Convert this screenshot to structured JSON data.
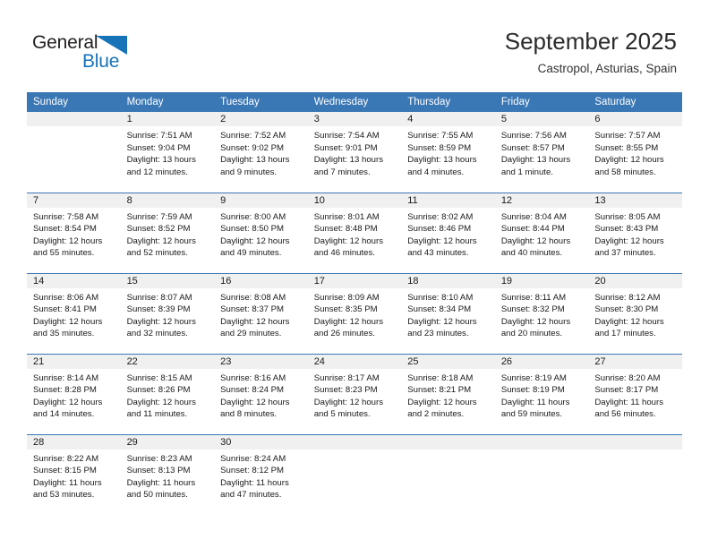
{
  "brand": {
    "name_top": "General",
    "name_bottom": "Blue",
    "accent_color": "#1673b8"
  },
  "header": {
    "title": "September 2025",
    "subtitle": "Castropol, Asturias, Spain"
  },
  "theme": {
    "header_row_color": "#3a77b5",
    "daynum_band_color": "#f0f0f0",
    "text_color": "#1a1a1a"
  },
  "weekday_headers": [
    "Sunday",
    "Monday",
    "Tuesday",
    "Wednesday",
    "Thursday",
    "Friday",
    "Saturday"
  ],
  "weeks": [
    [
      {
        "day": "",
        "blank": true,
        "sunrise": "",
        "sunset": "",
        "daylight_line1": "",
        "daylight_line2": ""
      },
      {
        "day": "1",
        "sunrise": "Sunrise: 7:51 AM",
        "sunset": "Sunset: 9:04 PM",
        "daylight_line1": "Daylight: 13 hours",
        "daylight_line2": "and 12 minutes."
      },
      {
        "day": "2",
        "sunrise": "Sunrise: 7:52 AM",
        "sunset": "Sunset: 9:02 PM",
        "daylight_line1": "Daylight: 13 hours",
        "daylight_line2": "and 9 minutes."
      },
      {
        "day": "3",
        "sunrise": "Sunrise: 7:54 AM",
        "sunset": "Sunset: 9:01 PM",
        "daylight_line1": "Daylight: 13 hours",
        "daylight_line2": "and 7 minutes."
      },
      {
        "day": "4",
        "sunrise": "Sunrise: 7:55 AM",
        "sunset": "Sunset: 8:59 PM",
        "daylight_line1": "Daylight: 13 hours",
        "daylight_line2": "and 4 minutes."
      },
      {
        "day": "5",
        "sunrise": "Sunrise: 7:56 AM",
        "sunset": "Sunset: 8:57 PM",
        "daylight_line1": "Daylight: 13 hours",
        "daylight_line2": "and 1 minute."
      },
      {
        "day": "6",
        "sunrise": "Sunrise: 7:57 AM",
        "sunset": "Sunset: 8:55 PM",
        "daylight_line1": "Daylight: 12 hours",
        "daylight_line2": "and 58 minutes."
      }
    ],
    [
      {
        "day": "7",
        "sunrise": "Sunrise: 7:58 AM",
        "sunset": "Sunset: 8:54 PM",
        "daylight_line1": "Daylight: 12 hours",
        "daylight_line2": "and 55 minutes."
      },
      {
        "day": "8",
        "sunrise": "Sunrise: 7:59 AM",
        "sunset": "Sunset: 8:52 PM",
        "daylight_line1": "Daylight: 12 hours",
        "daylight_line2": "and 52 minutes."
      },
      {
        "day": "9",
        "sunrise": "Sunrise: 8:00 AM",
        "sunset": "Sunset: 8:50 PM",
        "daylight_line1": "Daylight: 12 hours",
        "daylight_line2": "and 49 minutes."
      },
      {
        "day": "10",
        "sunrise": "Sunrise: 8:01 AM",
        "sunset": "Sunset: 8:48 PM",
        "daylight_line1": "Daylight: 12 hours",
        "daylight_line2": "and 46 minutes."
      },
      {
        "day": "11",
        "sunrise": "Sunrise: 8:02 AM",
        "sunset": "Sunset: 8:46 PM",
        "daylight_line1": "Daylight: 12 hours",
        "daylight_line2": "and 43 minutes."
      },
      {
        "day": "12",
        "sunrise": "Sunrise: 8:04 AM",
        "sunset": "Sunset: 8:44 PM",
        "daylight_line1": "Daylight: 12 hours",
        "daylight_line2": "and 40 minutes."
      },
      {
        "day": "13",
        "sunrise": "Sunrise: 8:05 AM",
        "sunset": "Sunset: 8:43 PM",
        "daylight_line1": "Daylight: 12 hours",
        "daylight_line2": "and 37 minutes."
      }
    ],
    [
      {
        "day": "14",
        "sunrise": "Sunrise: 8:06 AM",
        "sunset": "Sunset: 8:41 PM",
        "daylight_line1": "Daylight: 12 hours",
        "daylight_line2": "and 35 minutes."
      },
      {
        "day": "15",
        "sunrise": "Sunrise: 8:07 AM",
        "sunset": "Sunset: 8:39 PM",
        "daylight_line1": "Daylight: 12 hours",
        "daylight_line2": "and 32 minutes."
      },
      {
        "day": "16",
        "sunrise": "Sunrise: 8:08 AM",
        "sunset": "Sunset: 8:37 PM",
        "daylight_line1": "Daylight: 12 hours",
        "daylight_line2": "and 29 minutes."
      },
      {
        "day": "17",
        "sunrise": "Sunrise: 8:09 AM",
        "sunset": "Sunset: 8:35 PM",
        "daylight_line1": "Daylight: 12 hours",
        "daylight_line2": "and 26 minutes."
      },
      {
        "day": "18",
        "sunrise": "Sunrise: 8:10 AM",
        "sunset": "Sunset: 8:34 PM",
        "daylight_line1": "Daylight: 12 hours",
        "daylight_line2": "and 23 minutes."
      },
      {
        "day": "19",
        "sunrise": "Sunrise: 8:11 AM",
        "sunset": "Sunset: 8:32 PM",
        "daylight_line1": "Daylight: 12 hours",
        "daylight_line2": "and 20 minutes."
      },
      {
        "day": "20",
        "sunrise": "Sunrise: 8:12 AM",
        "sunset": "Sunset: 8:30 PM",
        "daylight_line1": "Daylight: 12 hours",
        "daylight_line2": "and 17 minutes."
      }
    ],
    [
      {
        "day": "21",
        "sunrise": "Sunrise: 8:14 AM",
        "sunset": "Sunset: 8:28 PM",
        "daylight_line1": "Daylight: 12 hours",
        "daylight_line2": "and 14 minutes."
      },
      {
        "day": "22",
        "sunrise": "Sunrise: 8:15 AM",
        "sunset": "Sunset: 8:26 PM",
        "daylight_line1": "Daylight: 12 hours",
        "daylight_line2": "and 11 minutes."
      },
      {
        "day": "23",
        "sunrise": "Sunrise: 8:16 AM",
        "sunset": "Sunset: 8:24 PM",
        "daylight_line1": "Daylight: 12 hours",
        "daylight_line2": "and 8 minutes."
      },
      {
        "day": "24",
        "sunrise": "Sunrise: 8:17 AM",
        "sunset": "Sunset: 8:23 PM",
        "daylight_line1": "Daylight: 12 hours",
        "daylight_line2": "and 5 minutes."
      },
      {
        "day": "25",
        "sunrise": "Sunrise: 8:18 AM",
        "sunset": "Sunset: 8:21 PM",
        "daylight_line1": "Daylight: 12 hours",
        "daylight_line2": "and 2 minutes."
      },
      {
        "day": "26",
        "sunrise": "Sunrise: 8:19 AM",
        "sunset": "Sunset: 8:19 PM",
        "daylight_line1": "Daylight: 11 hours",
        "daylight_line2": "and 59 minutes."
      },
      {
        "day": "27",
        "sunrise": "Sunrise: 8:20 AM",
        "sunset": "Sunset: 8:17 PM",
        "daylight_line1": "Daylight: 11 hours",
        "daylight_line2": "and 56 minutes."
      }
    ],
    [
      {
        "day": "28",
        "sunrise": "Sunrise: 8:22 AM",
        "sunset": "Sunset: 8:15 PM",
        "daylight_line1": "Daylight: 11 hours",
        "daylight_line2": "and 53 minutes."
      },
      {
        "day": "29",
        "sunrise": "Sunrise: 8:23 AM",
        "sunset": "Sunset: 8:13 PM",
        "daylight_line1": "Daylight: 11 hours",
        "daylight_line2": "and 50 minutes."
      },
      {
        "day": "30",
        "sunrise": "Sunrise: 8:24 AM",
        "sunset": "Sunset: 8:12 PM",
        "daylight_line1": "Daylight: 11 hours",
        "daylight_line2": "and 47 minutes."
      },
      {
        "day": "",
        "blank": true,
        "sunrise": "",
        "sunset": "",
        "daylight_line1": "",
        "daylight_line2": ""
      },
      {
        "day": "",
        "blank": true,
        "sunrise": "",
        "sunset": "",
        "daylight_line1": "",
        "daylight_line2": ""
      },
      {
        "day": "",
        "blank": true,
        "sunrise": "",
        "sunset": "",
        "daylight_line1": "",
        "daylight_line2": ""
      },
      {
        "day": "",
        "blank": true,
        "sunrise": "",
        "sunset": "",
        "daylight_line1": "",
        "daylight_line2": ""
      }
    ]
  ]
}
